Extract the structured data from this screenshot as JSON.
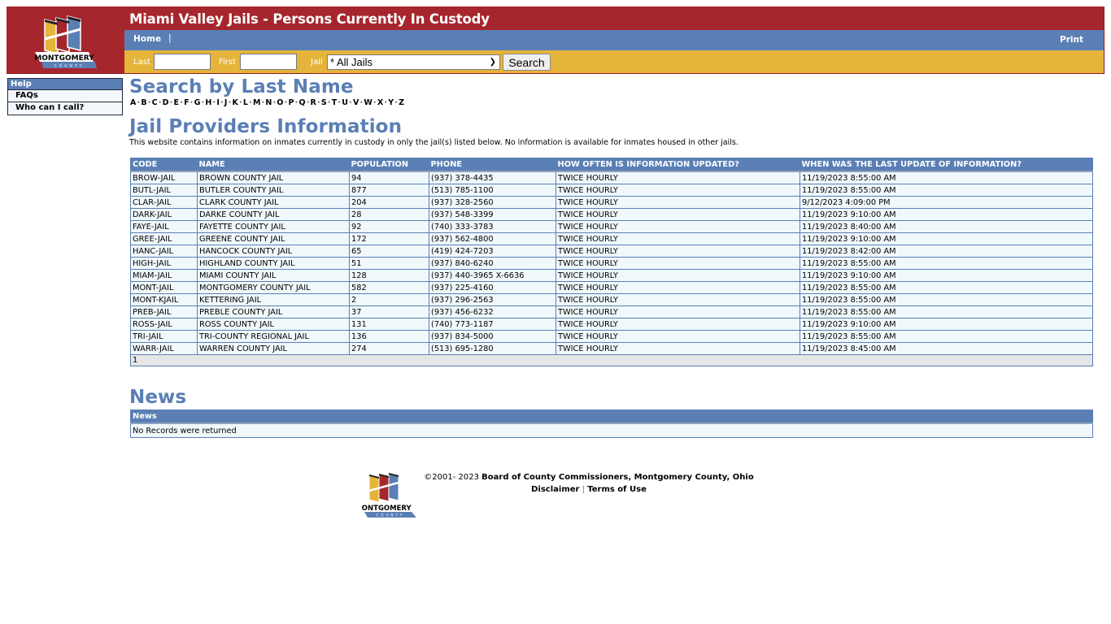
{
  "header": {
    "title": "Miami Valley Jails - Persons Currently In Custody",
    "logo": "montgomery-county-logo",
    "logo_text": "MONTGOMERY",
    "logo_subtext": "COUNTY",
    "colors": {
      "brand_red": "#a6262d",
      "nav_blue": "#5a7fb5",
      "search_gold": "#e5b43a"
    }
  },
  "nav": {
    "home": "Home",
    "separator": "|",
    "print": "Print"
  },
  "search": {
    "last_label": "Last",
    "last_value": "",
    "first_label": "First",
    "first_value": "",
    "jail_label": "Jail",
    "jail_selected": "* All Jails",
    "search_button": "Search"
  },
  "sidebar": {
    "heading": "Help",
    "items": [
      {
        "label": "FAQs"
      },
      {
        "label": "Who can I call?"
      }
    ]
  },
  "search_by_last_name": {
    "heading": "Search by Last Name",
    "letters": [
      "A",
      "B",
      "C",
      "D",
      "E",
      "F",
      "G",
      "H",
      "I",
      "J",
      "K",
      "L",
      "M",
      "N",
      "O",
      "P",
      "Q",
      "R",
      "S",
      "T",
      "U",
      "V",
      "W",
      "X",
      "Y",
      "Z"
    ]
  },
  "providers": {
    "heading": "Jail Providers Information",
    "intro": "This website contains information on inmates currently in custody in only the jail(s) listed below. No information is available for inmates housed in other jails.",
    "columns": [
      "CODE",
      "NAME",
      "POPULATION",
      "PHONE",
      "HOW OFTEN IS INFORMATION UPDATED?",
      "WHEN WAS THE LAST UPDATE OF INFORMATION?"
    ],
    "rows": [
      [
        "BROW-JAIL",
        "BROWN COUNTY JAIL",
        "94",
        "(937) 378-4435",
        "TWICE HOURLY",
        "11/19/2023 8:55:00 AM"
      ],
      [
        "BUTL-JAIL",
        "BUTLER COUNTY JAIL",
        "877",
        "(513) 785-1100",
        "TWICE HOURLY",
        "11/19/2023 8:55:00 AM"
      ],
      [
        "CLAR-JAIL",
        "CLARK COUNTY JAIL",
        "204",
        "(937) 328-2560",
        "TWICE HOURLY",
        "9/12/2023 4:09:00 PM"
      ],
      [
        "DARK-JAIL",
        "DARKE COUNTY JAIL",
        "28",
        "(937) 548-3399",
        "TWICE HOURLY",
        "11/19/2023 9:10:00 AM"
      ],
      [
        "FAYE-JAIL",
        "FAYETTE COUNTY JAIL",
        "92",
        "(740) 333-3783",
        "TWICE HOURLY",
        "11/19/2023 8:40:00 AM"
      ],
      [
        "GREE-JAIL",
        "GREENE COUNTY JAIL",
        "172",
        "(937) 562-4800",
        "TWICE HOURLY",
        "11/19/2023 9:10:00 AM"
      ],
      [
        "HANC-JAIL",
        "HANCOCK COUNTY JAIL",
        "65",
        "(419) 424-7203",
        "TWICE HOURLY",
        "11/19/2023 8:42:00 AM"
      ],
      [
        "HIGH-JAIL",
        "HIGHLAND COUNTY JAIL",
        "51",
        "(937) 840-6240",
        "TWICE HOURLY",
        "11/19/2023 8:55:00 AM"
      ],
      [
        "MIAM-JAIL",
        "MIAMI COUNTY JAIL",
        "128",
        "(937) 440-3965 X-6636",
        "TWICE HOURLY",
        "11/19/2023 9:10:00 AM"
      ],
      [
        "MONT-JAIL",
        "MONTGOMERY COUNTY JAIL",
        "582",
        "(937) 225-4160",
        "TWICE HOURLY",
        "11/19/2023 8:55:00 AM"
      ],
      [
        "MONT-KJAIL",
        "KETTERING JAIL",
        "2",
        "(937) 296-2563",
        "TWICE HOURLY",
        "11/19/2023 8:55:00 AM"
      ],
      [
        "PREB-JAIL",
        "PREBLE COUNTY JAIL",
        "37",
        "(937) 456-6232",
        "TWICE HOURLY",
        "11/19/2023 8:55:00 AM"
      ],
      [
        "ROSS-JAIL",
        "ROSS COUNTY JAIL",
        "131",
        "(740) 773-1187",
        "TWICE HOURLY",
        "11/19/2023 9:10:00 AM"
      ],
      [
        "TRI-JAIL",
        "TRI-COUNTY REGIONAL JAIL",
        "136",
        "(937) 834-5000",
        "TWICE HOURLY",
        "11/19/2023 8:55:00 AM"
      ],
      [
        "WARR-JAIL",
        "WARREN COUNTY JAIL",
        "274",
        "(513) 695-1280",
        "TWICE HOURLY",
        "11/19/2023 8:45:00 AM"
      ]
    ],
    "pager": "1"
  },
  "news": {
    "heading": "News",
    "table_header": "News",
    "empty_message": "No Records were returned"
  },
  "footer": {
    "copyright_prefix": "©2001- 2023",
    "copyright_owner": "Board of County Commissioners, Montgomery County, Ohio",
    "disclaimer": "Disclaimer",
    "separator": "|",
    "terms": "Terms of Use"
  }
}
